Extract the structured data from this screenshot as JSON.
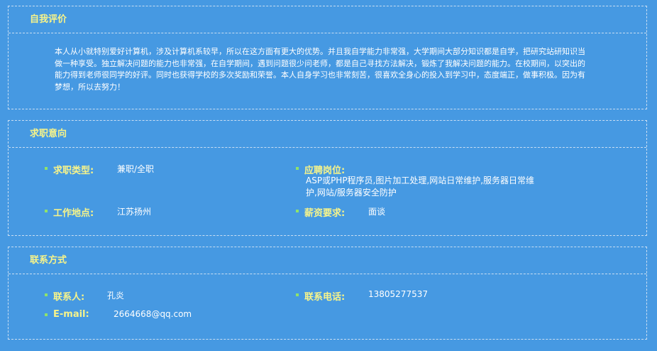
{
  "self_eval": {
    "title": "自我评价",
    "text": "本人从小就特别爱好计算机，涉及计算机系较早，所以在这方面有更大的优势。并且我自学能力非常强，大学期间大部分知识都是自学，把研究站研知识当做一种享受。独立解决问题的能力也非常强，在自学期间，遇到问题很少问老师，都是自己寻找方法解决，锻炼了我解决问题的能力。在校期间，以突出的能力得到老师很同学的好评。同时也获得学校的多次奖励和荣誉。本人自身学习也非常刻苦，很喜欢全身心的投入到学习中，态度端正，做事积极。因为有梦想，所以去努力！"
  },
  "job_intent": {
    "title": "求职意向",
    "job_type_label": "求职类型:",
    "job_type_value": "兼职/全职",
    "position_label": "应聘岗位:",
    "position_value": "ASP或PHP程序员,图片加工处理,网站日常维护,服务器日常维护,网站/服务器安全防护",
    "location_label": "工作地点:",
    "location_value": "江苏扬州",
    "salary_label": "薪资要求:",
    "salary_value": "面谈"
  },
  "contact": {
    "title": "联系方式",
    "person_label": "联系人:",
    "person_value": "孔炎",
    "phone_label": "联系电话:",
    "phone_value": "13805277537",
    "email_label": "E-mail:",
    "email_value": "2664668@qq.com"
  }
}
